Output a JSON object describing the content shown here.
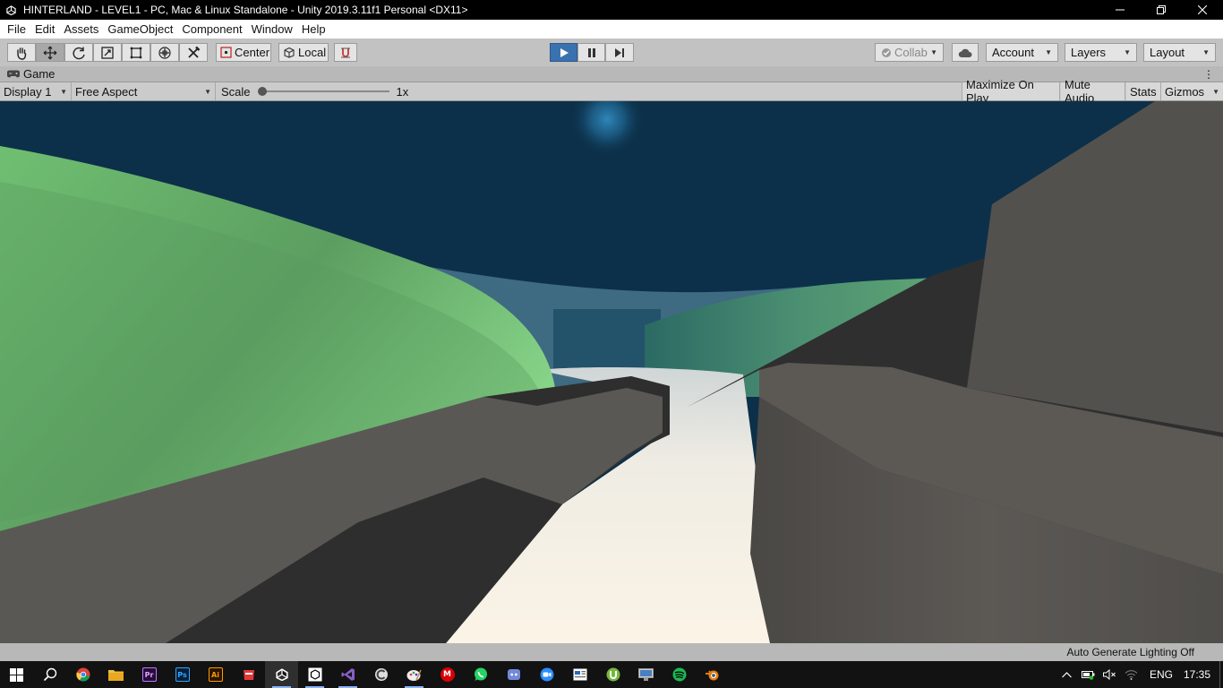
{
  "window": {
    "title": "HINTERLAND - LEVEL1 - PC, Mac & Linux Standalone - Unity 2019.3.11f1 Personal <DX11>"
  },
  "menu": [
    "File",
    "Edit",
    "Assets",
    "GameObject",
    "Component",
    "Window",
    "Help"
  ],
  "toolbar": {
    "pivot_label": "Center",
    "space_label": "Local",
    "collab_label": "Collab",
    "account_label": "Account",
    "layers_label": "Layers",
    "layout_label": "Layout"
  },
  "game_tab": {
    "label": "Game"
  },
  "game_bar": {
    "display": "Display 1",
    "aspect": "Free Aspect",
    "scale_label": "Scale",
    "scale_value": "1x",
    "scale_slider_level": 0,
    "maximize_on_play": "Maximize On Play",
    "mute_audio": "Mute Audio",
    "stats": "Stats",
    "gizmos": "Gizmos"
  },
  "status": {
    "text": "Auto Generate Lighting Off"
  },
  "colors": {
    "sky": "#0c3049",
    "hill_green": "#7dcc7f",
    "path": "#f6f1e6",
    "rock_dark": "#2e2e2e",
    "rock_light": "#5a5854",
    "play_active": "#3a72b0"
  },
  "taskbar": {
    "apps": [
      "start-icon",
      "search-icon",
      "chrome-icon",
      "file-explorer-icon",
      "premiere-icon",
      "photoshop-icon",
      "illustrator-icon",
      "storage-app-icon",
      "unity-icon",
      "unity-hub-icon",
      "visual-studio-icon",
      "ccleaner-icon",
      "paint-icon",
      "mega-icon",
      "whatsapp-icon",
      "discord-icon",
      "zoom-icon",
      "news-app-icon",
      "utorrent-icon",
      "remote-desktop-icon",
      "spotify-icon",
      "blender-icon"
    ],
    "app_labels": {
      "premiere": "Pr",
      "photoshop": "Ps",
      "illustrator": "Ai",
      "mega": "M"
    },
    "language": "ENG",
    "time": "17:35"
  }
}
